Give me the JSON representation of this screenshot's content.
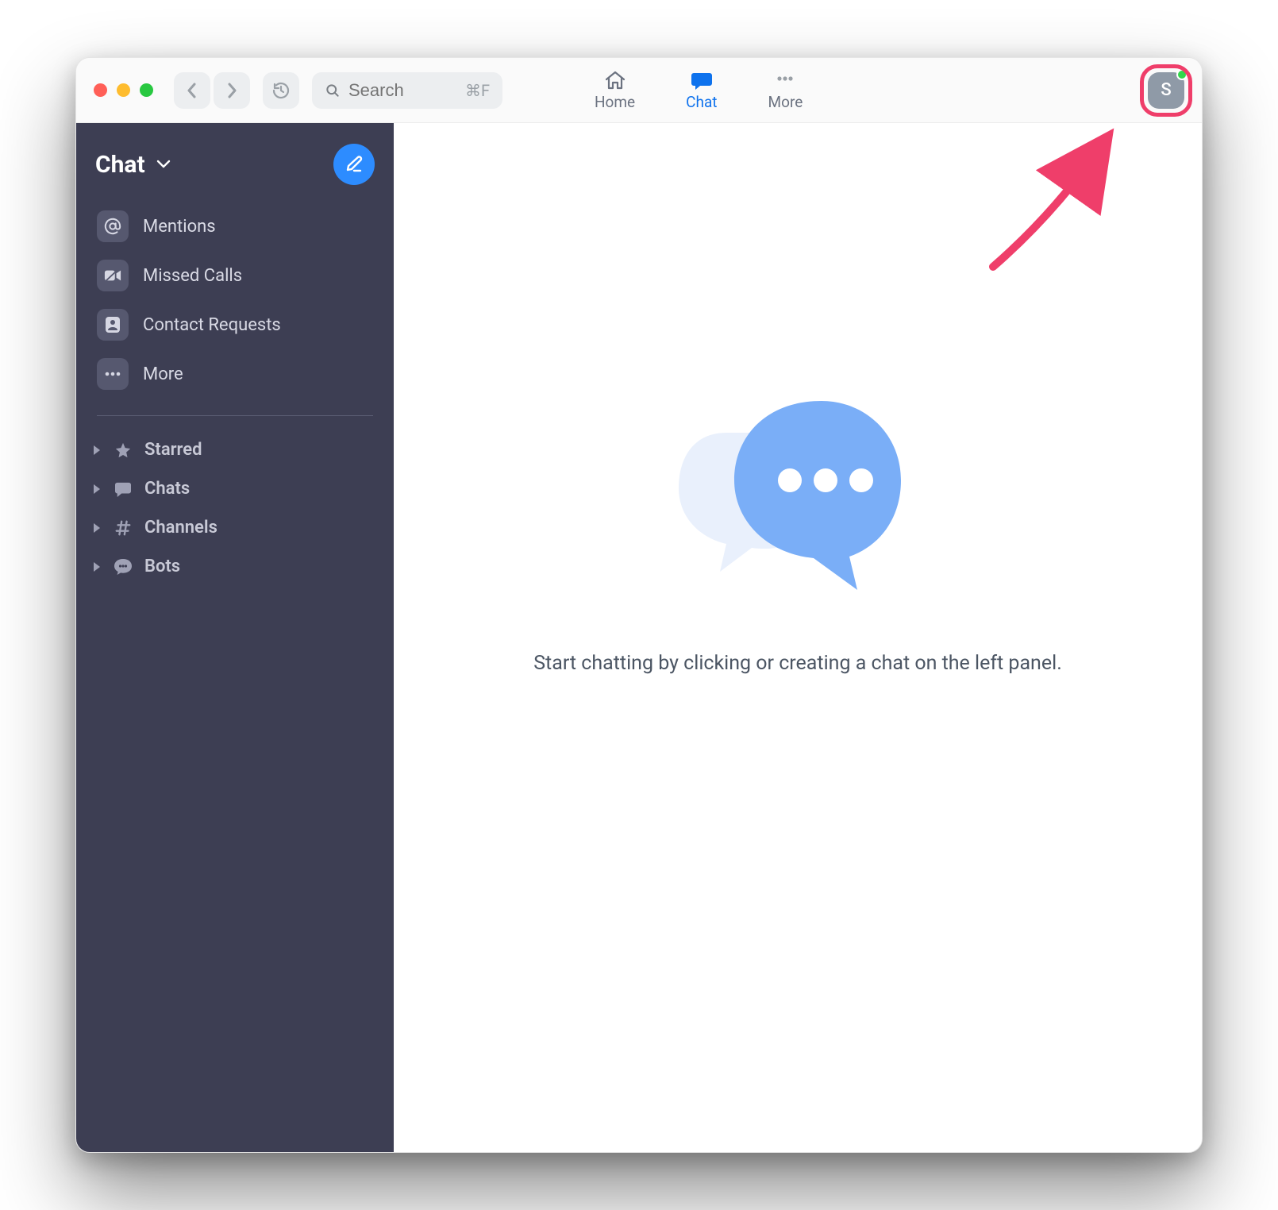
{
  "colors": {
    "accent": "#0e72ed",
    "sidebar_bg": "#3d3e53",
    "highlight": "#ef3e6a",
    "presence": "#32d74b"
  },
  "titlebar": {
    "search_placeholder": "Search",
    "search_shortcut": "⌘F",
    "tabs": {
      "home": "Home",
      "chat": "Chat",
      "more": "More"
    }
  },
  "avatar": {
    "initial": "S"
  },
  "sidebar": {
    "title": "Chat",
    "items": {
      "mentions": "Mentions",
      "missed_calls": "Missed Calls",
      "contact_requests": "Contact Requests",
      "more": "More"
    },
    "sections": {
      "starred": "Starred",
      "chats": "Chats",
      "channels": "Channels",
      "bots": "Bots"
    }
  },
  "main": {
    "empty_text": "Start chatting by clicking or creating a chat on the left panel."
  },
  "icons": {
    "home": "home-icon",
    "chat": "chat-bubble-icon",
    "more": "ellipsis-icon",
    "search": "search-icon",
    "back": "chevron-left-icon",
    "forward": "chevron-right-icon",
    "history": "history-icon",
    "compose": "compose-icon",
    "chevron_down": "chevron-down-icon",
    "mention": "at-icon",
    "video_missed": "video-off-icon",
    "contact": "contact-icon",
    "ellipsis": "ellipsis-icon",
    "star": "star-icon",
    "chat_filled": "speech-icon",
    "hash": "hash-icon",
    "bot": "bot-speech-icon"
  }
}
